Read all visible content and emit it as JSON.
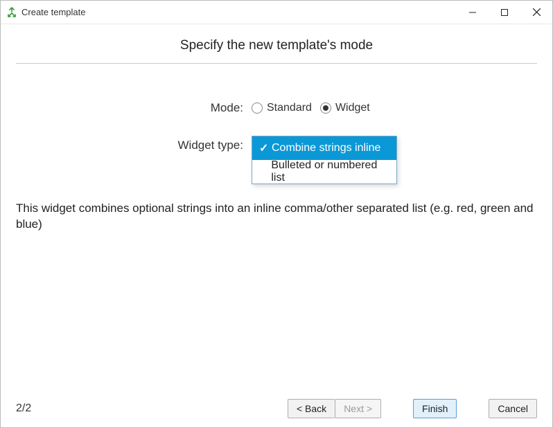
{
  "window": {
    "title": "Create template"
  },
  "heading": "Specify the new template's mode",
  "form": {
    "mode_label": "Mode:",
    "mode_options": {
      "standard": "Standard",
      "widget": "Widget"
    },
    "mode_selected": "widget",
    "widget_type_label": "Widget type:",
    "widget_type_options": [
      "Combine strings inline",
      "Bulleted or numbered list"
    ],
    "widget_type_selected_index": 0
  },
  "description": "This widget combines optional strings into an inline comma/other separated list (e.g. red, green and blue)",
  "footer": {
    "page_indicator": "2/2",
    "back_label": "< Back",
    "next_label": "Next >",
    "finish_label": "Finish",
    "cancel_label": "Cancel"
  }
}
